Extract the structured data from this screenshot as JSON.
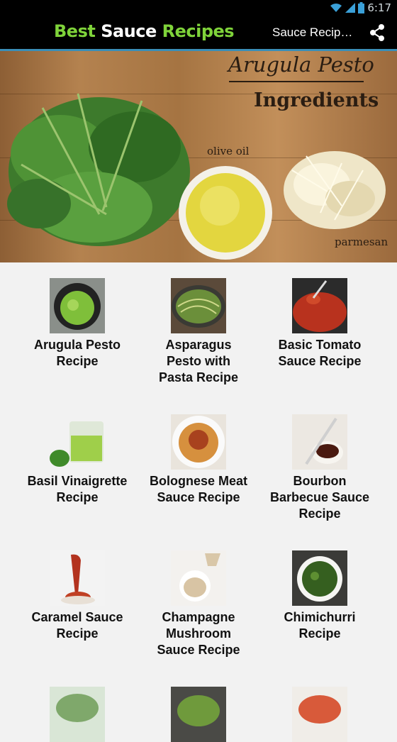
{
  "status_bar": {
    "time": "6:17",
    "icons": [
      "wifi-icon",
      "signal-icon",
      "battery-icon"
    ]
  },
  "action_bar": {
    "app_title_words": [
      "Best",
      "Sauce",
      "Recipes"
    ],
    "current_title": "Sauce Recip…",
    "share_icon": "share-icon",
    "colors": {
      "title_green": "#7fd33a",
      "bar_background": "#000000",
      "bar_underline": "#3b8fb8"
    }
  },
  "hero": {
    "title": "Arugula Pesto",
    "subtitle": "Ingredients",
    "label_oil": "olive oil",
    "label_cheese": "parmesan"
  },
  "recipes": [
    {
      "line1": "Arugula Pesto",
      "line2": "Recipe",
      "line3": ""
    },
    {
      "line1": "Asparagus",
      "line2": "Pesto with",
      "line3": "Pasta Recipe"
    },
    {
      "line1": "Basic Tomato",
      "line2": "Sauce Recipe",
      "line3": ""
    },
    {
      "line1": "Basil Vinaigrette",
      "line2": "Recipe",
      "line3": ""
    },
    {
      "line1": "Bolognese Meat",
      "line2": "Sauce Recipe",
      "line3": ""
    },
    {
      "line1": "Bourbon",
      "line2": "Barbecue Sauce",
      "line3": "Recipe"
    },
    {
      "line1": "Caramel Sauce",
      "line2": "Recipe",
      "line3": ""
    },
    {
      "line1": "Champagne",
      "line2": "Mushroom",
      "line3": "Sauce Recipe"
    },
    {
      "line1": "Chimichurri",
      "line2": "Recipe",
      "line3": ""
    }
  ]
}
